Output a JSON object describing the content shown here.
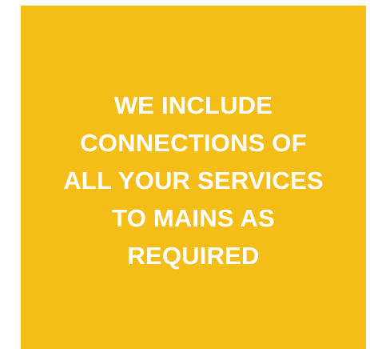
{
  "panel": {
    "background_color": "#f5bd18",
    "text_color": "#ffffff",
    "lines": [
      "WE INCLUDE",
      "CONNECTIONS OF",
      "ALL YOUR SERVICES",
      "TO MAINS AS",
      "REQUIRED"
    ]
  }
}
